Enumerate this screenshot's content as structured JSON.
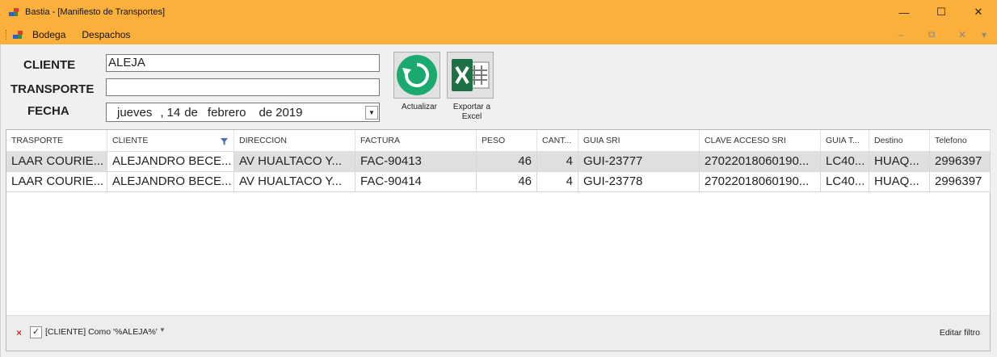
{
  "window": {
    "title": "Bastia - [Manifiesto de Transportes]",
    "minimize": "—",
    "maximize": "☐",
    "close": "✕"
  },
  "menu": {
    "items": [
      "Bodega",
      "Despachos"
    ],
    "mdi_minimize": "–",
    "mdi_restore": "⧉",
    "mdi_close": "✕",
    "mdi_arrow": "▾"
  },
  "form": {
    "cliente_label": "CLIENTE",
    "transporte_label": "TRANSPORTE",
    "fecha_label": "FECHA",
    "cliente_value": "ALEJA",
    "transporte_value": "",
    "fecha": {
      "day_name": "jueves",
      "day": "14",
      "de1": "de",
      "month": "febrero",
      "de2": "de",
      "year": "2019"
    }
  },
  "buttons": {
    "actualizar": "Actualizar",
    "exportar_line1": "Exportar a",
    "exportar_line2": "Excel"
  },
  "grid": {
    "headers": [
      "TRASPORTE",
      "CLIENTE",
      "DIRECCION",
      "FACTURA",
      "PESO",
      "CANT...",
      "GUIA SRI",
      "CLAVE ACCESO SRI",
      "GUIA T...",
      "Destino",
      "Telefono"
    ],
    "rows": [
      [
        "LAAR COURIE...",
        "ALEJANDRO BECE...",
        "AV HUALTACO Y...",
        "FAC-90413",
        "46",
        "4",
        "GUI-23777",
        "27022018060190...",
        "LC40...",
        "HUAQ...",
        "2996397"
      ],
      [
        "LAAR COURIE...",
        "ALEJANDRO BECE...",
        "AV HUALTACO Y...",
        "FAC-90414",
        "46",
        "4",
        "GUI-23778",
        "27022018060190...",
        "LC40...",
        "HUAQ...",
        "2996397"
      ]
    ],
    "filter_text": "[CLIENTE] Como '%ALEJA%'",
    "edit_filter": "Editar filtro",
    "filter_remove": "×",
    "filter_check": "✓",
    "filter_arrow": "▼"
  },
  "colors": {
    "titlebar": "#fbb03b",
    "refresh_green": "#1aa96e",
    "excel_green": "#1e7145"
  }
}
